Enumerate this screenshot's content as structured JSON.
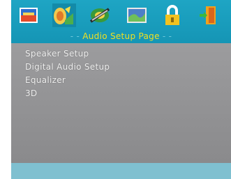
{
  "header": {
    "title_dash_left": "- -",
    "title": "Audio Setup Page",
    "title_dash_right": "- -",
    "icons": [
      "general-setup-icon",
      "audio-setup-icon",
      "video-setup-icon",
      "preference-icon",
      "password-lock-icon",
      "exit-door-icon"
    ],
    "selected_icon": "audio-setup-icon"
  },
  "menu": {
    "items": [
      {
        "label": "Speaker  Setup"
      },
      {
        "label": "Digital  Audio  Setup"
      },
      {
        "label": "Equalizer"
      },
      {
        "label": "3D"
      }
    ]
  },
  "colors": {
    "header_bg": "#1ea5c4",
    "title_text": "#f0e020",
    "menu_text": "#f1f1f1",
    "content_bg": "#8f8f91",
    "footer_bg": "#7fc0d0"
  }
}
